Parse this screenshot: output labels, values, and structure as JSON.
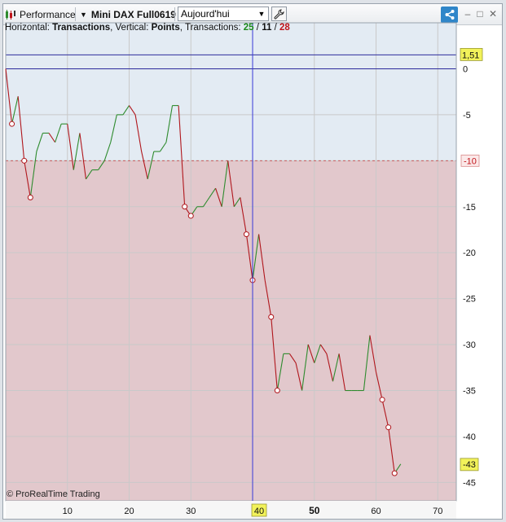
{
  "toolbar": {
    "title": "Performance",
    "instrument": "Mini DAX Full0619",
    "period": "Aujourd'hui",
    "minimize": "–",
    "restore": "□",
    "close": "✕"
  },
  "info": {
    "h_label": "Horizontal:",
    "h_value": "Transactions",
    "v_label": "Vertical:",
    "v_value": "Points",
    "t_label": "Transactions:",
    "total": "25",
    "slash1": "/",
    "wins": "11",
    "slash2": "/",
    "losses": "28"
  },
  "copyright": "© ProRealTime Trading",
  "colors": {
    "upper_zone": "#e3ebf3",
    "lower_zone": "#e2c8cc",
    "up_segment": "#2e8b2e",
    "down_segment": "#b0161c",
    "cursor": "#3a3ad8",
    "zero_line": "#2c2c9c",
    "label_box": "#f2f25a"
  },
  "chart_data": {
    "type": "line",
    "xlim": [
      0,
      73
    ],
    "ylim": [
      -47,
      5
    ],
    "x_ticks": [
      10,
      20,
      30,
      40,
      50,
      60,
      70
    ],
    "y_ticks": [
      0,
      -5,
      -10,
      -15,
      -20,
      -25,
      -30,
      -35,
      -40,
      -45
    ],
    "y_tick_labels": [
      "0",
      "-5",
      "-10",
      "-15",
      "-20",
      "-25",
      "-30",
      "-35",
      "-40",
      "-45"
    ],
    "threshold": -10,
    "threshold_label": "-10",
    "upper_line": 1.51,
    "upper_line_label": "1,51",
    "last_value_label": "-43",
    "cursor_x": 40,
    "cursor_x_label": "40",
    "highlighted_x_label": "50",
    "x": [
      0,
      1,
      2,
      3,
      4,
      5,
      6,
      7,
      8,
      9,
      10,
      11,
      12,
      13,
      14,
      15,
      16,
      17,
      18,
      19,
      20,
      21,
      22,
      23,
      24,
      25,
      26,
      27,
      28,
      29,
      30,
      31,
      32,
      33,
      34,
      35,
      36,
      37,
      38,
      39,
      40,
      41,
      42,
      43,
      44,
      45,
      46,
      47,
      48,
      49,
      50,
      51,
      52,
      53,
      54,
      55,
      56,
      57,
      58,
      59,
      60,
      61,
      62,
      63,
      64
    ],
    "y": [
      0,
      -6,
      -3,
      -10,
      -14,
      -9,
      -7,
      -7,
      -8,
      -6,
      -6,
      -11,
      -7,
      -12,
      -11,
      -11,
      -10,
      -8,
      -5,
      -5,
      -4,
      -5,
      -9,
      -12,
      -9,
      -9,
      -8,
      -4,
      -4,
      -15,
      -16,
      -15,
      -15,
      -14,
      -13,
      -15,
      -10,
      -15,
      -14,
      -18,
      -23,
      -18,
      -23,
      -27,
      -35,
      -31,
      -31,
      -32,
      -35,
      -30,
      -32,
      -30,
      -31,
      -34,
      -31,
      -35,
      -35,
      -35,
      -35,
      -29,
      -33,
      -36,
      -39,
      -44,
      -43
    ],
    "markers_x": [
      1,
      3,
      4,
      29,
      30,
      39,
      40,
      43,
      44,
      61,
      62,
      63
    ]
  }
}
